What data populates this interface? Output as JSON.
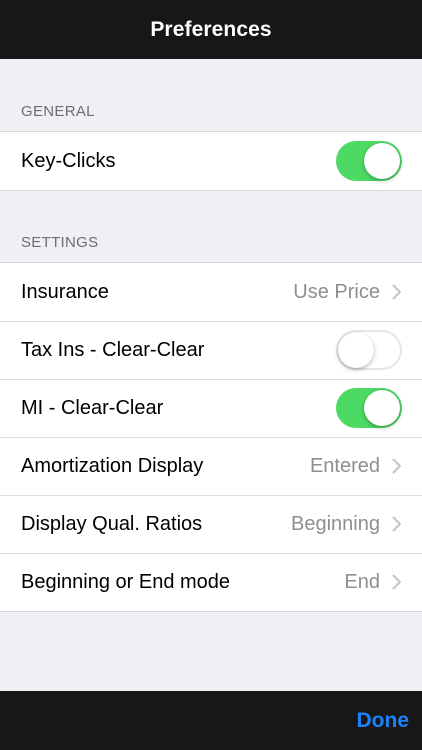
{
  "nav": {
    "title": "Preferences"
  },
  "general": {
    "header": "GENERAL",
    "items": [
      {
        "label": "Key-Clicks",
        "toggle": true
      }
    ]
  },
  "settings": {
    "header": "SETTINGS",
    "items": [
      {
        "label": "Insurance",
        "value": "Use Price"
      },
      {
        "label": "Tax Ins - Clear-Clear",
        "toggle": false
      },
      {
        "label": "MI - Clear-Clear",
        "toggle": true
      },
      {
        "label": "Amortization Display",
        "value": "Entered"
      },
      {
        "label": "Display Qual. Ratios",
        "value": "Beginning"
      },
      {
        "label": "Beginning or End mode",
        "value": "End"
      }
    ]
  },
  "toolbar": {
    "done_label": "Done"
  },
  "colors": {
    "toggle_on": "#4cd964",
    "accent": "#1a82fb",
    "bar_bg": "#171717"
  },
  "icons": {
    "disclosure": "chevron-right-icon"
  }
}
